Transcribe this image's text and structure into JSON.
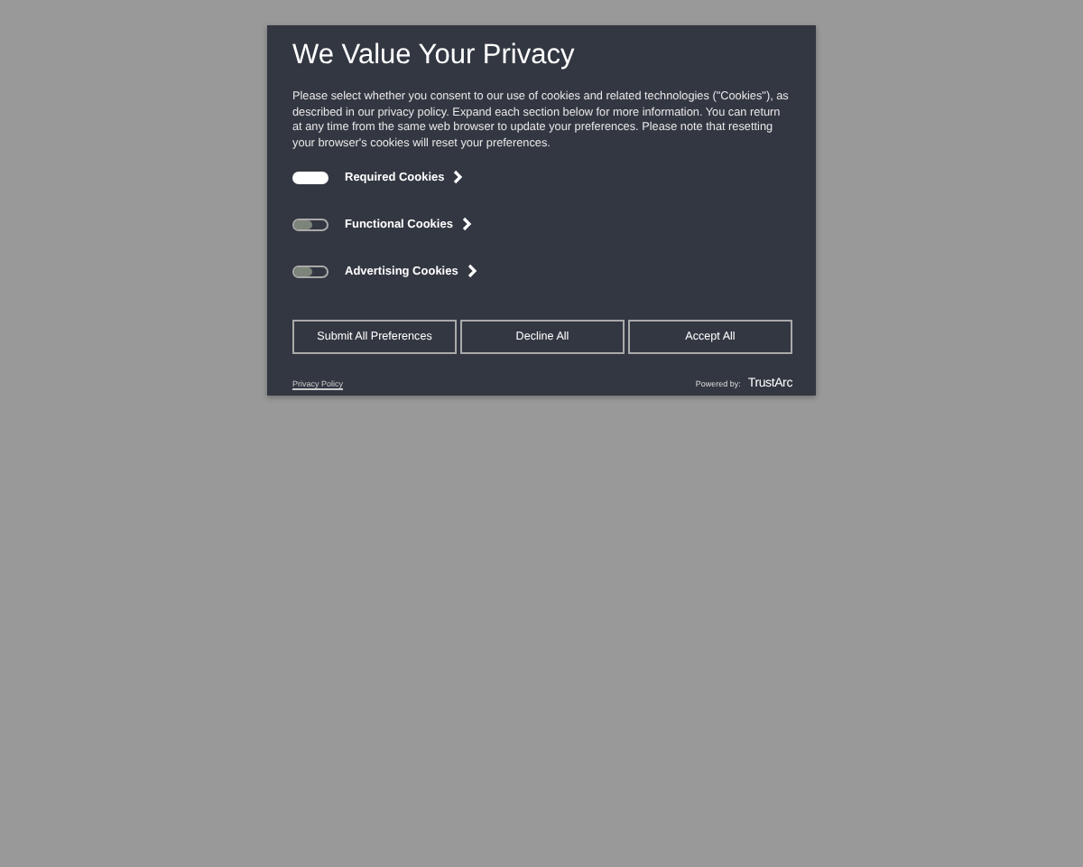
{
  "dialog": {
    "title": "We Value Your Privacy",
    "description": "Please select whether you consent to our use of cookies and related technologies (\"Cookies\"), as described in our privacy policy. Expand each section below for more information. You can return at any time from the same web browser to update your preferences. Please note that resetting your browser's cookies will reset your preferences.",
    "categories": [
      {
        "label": "Required Cookies",
        "on": true
      },
      {
        "label": "Functional Cookies",
        "on": false
      },
      {
        "label": "Advertising Cookies",
        "on": false
      }
    ],
    "buttons": [
      "Submit All Preferences",
      "Decline All",
      "Accept All"
    ],
    "privacy_link": "Privacy Policy",
    "powered_by": "Powered by:",
    "brand": "TrustArc"
  }
}
